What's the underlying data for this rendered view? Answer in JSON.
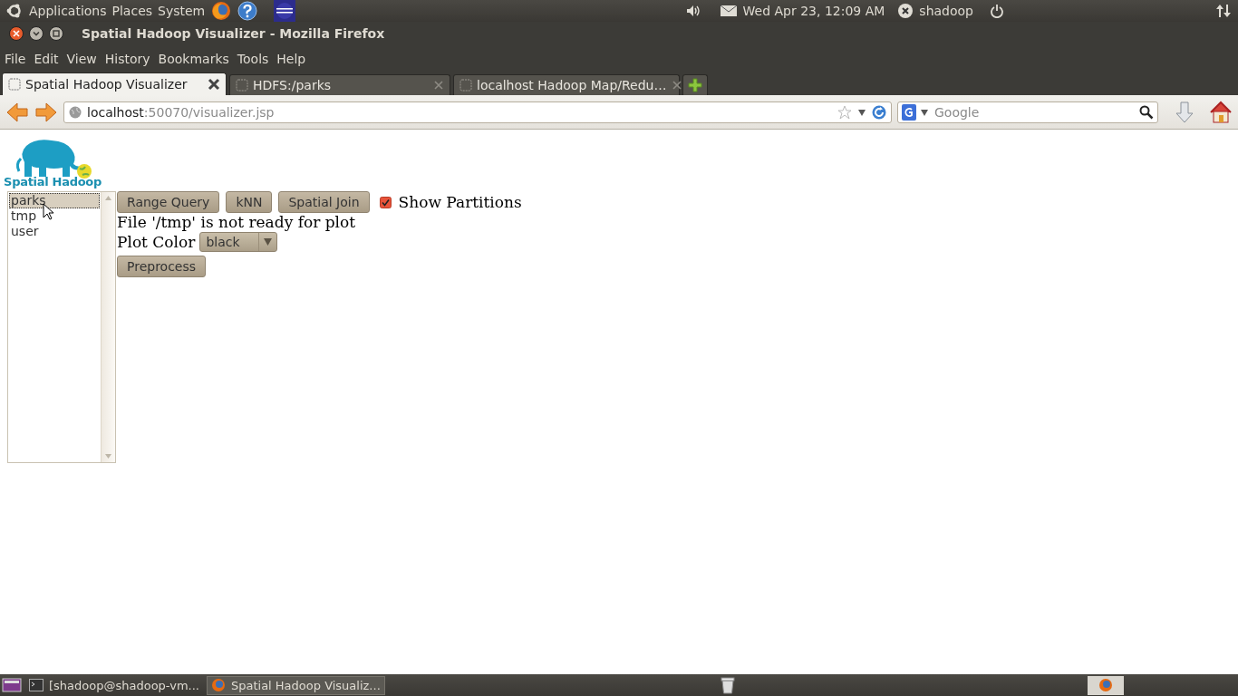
{
  "top_panel": {
    "menus": [
      "Applications",
      "Places",
      "System"
    ],
    "clock": "Wed Apr 23, 12:09 AM",
    "user": "shadoop"
  },
  "window": {
    "title": "Spatial Hadoop Visualizer - Mozilla Firefox"
  },
  "menu_bar": [
    "File",
    "Edit",
    "View",
    "History",
    "Bookmarks",
    "Tools",
    "Help"
  ],
  "tabs": [
    {
      "label": "Spatial Hadoop Visualizer",
      "selected": true
    },
    {
      "label": "HDFS:/parks",
      "selected": false
    },
    {
      "label": "localhost Hadoop Map/Redu…",
      "selected": false
    }
  ],
  "address_bar": {
    "host": "localhost",
    "path": ":50070/visualizer.jsp"
  },
  "search": {
    "placeholder": "Google"
  },
  "page": {
    "logo": "Spatial Hadoop",
    "files": [
      {
        "label": "parks",
        "selected": true
      },
      {
        "label": "tmp",
        "selected": false
      },
      {
        "label": "user",
        "selected": false
      }
    ],
    "buttons": [
      "Range Query",
      "kNN",
      "Spatial Join"
    ],
    "show_partitions": {
      "label": "Show Partitions",
      "checked": true
    },
    "message": "File '/tmp' is not ready for plot",
    "plot_color": {
      "label": "Plot Color",
      "value": "black"
    },
    "preprocess": "Preprocess"
  },
  "taskbar": {
    "tasks": [
      {
        "label": "[shadoop@shadoop-vm...",
        "selected": false
      },
      {
        "label": "Spatial Hadoop Visualiz...",
        "selected": true
      }
    ]
  }
}
